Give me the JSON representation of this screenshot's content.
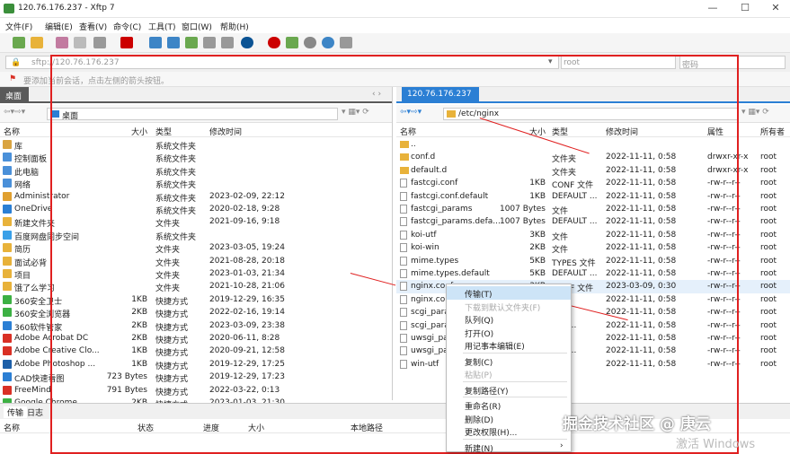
{
  "window": {
    "title": "120.76.176.237 - Xftp 7",
    "min": "—",
    "max": "☐",
    "close": "✕"
  },
  "menu": [
    "文件(F)",
    "编辑(E)",
    "查看(V)",
    "命令(C)",
    "工具(T)",
    "窗口(W)",
    "帮助(H)"
  ],
  "address": {
    "url": "sftp://120.76.176.237",
    "user_placeholder": "root",
    "pass_placeholder": "密码"
  },
  "hint": "要添加当前会话，点击左侧的箭头按钮。",
  "left": {
    "tab": "桌面",
    "path": "桌面",
    "headers": [
      "名称",
      "大小",
      "类型",
      "修改时间"
    ],
    "rows": [
      {
        "name": "库",
        "size": "",
        "type": "系统文件夹",
        "time": "",
        "c": "#d9a441"
      },
      {
        "name": "控制面板",
        "size": "",
        "type": "系统文件夹",
        "time": "",
        "c": "#4a90d9"
      },
      {
        "name": "此电脑",
        "size": "",
        "type": "系统文件夹",
        "time": "",
        "c": "#4a90d9"
      },
      {
        "name": "网络",
        "size": "",
        "type": "系统文件夹",
        "time": "",
        "c": "#4a90d9"
      },
      {
        "name": "Administrator",
        "size": "",
        "type": "系统文件夹",
        "time": "2023-02-09, 22:12",
        "c": "#e0a030"
      },
      {
        "name": "OneDrive",
        "size": "",
        "type": "系统文件夹",
        "time": "2020-02-18, 9:28",
        "c": "#2b7fd4"
      },
      {
        "name": "新建文件夹",
        "size": "",
        "type": "文件夹",
        "time": "2021-09-16, 9:18",
        "c": "#e8b23a"
      },
      {
        "name": "百度网盘同步空间",
        "size": "",
        "type": "系统文件夹",
        "time": "",
        "c": "#3aa0e8"
      },
      {
        "name": "简历",
        "size": "",
        "type": "文件夹",
        "time": "2023-03-05, 19:24",
        "c": "#e8b23a"
      },
      {
        "name": "面试必背",
        "size": "",
        "type": "文件夹",
        "time": "2021-08-28, 20:18",
        "c": "#e8b23a"
      },
      {
        "name": "项目",
        "size": "",
        "type": "文件夹",
        "time": "2023-01-03, 21:34",
        "c": "#e8b23a"
      },
      {
        "name": "饿了么学习",
        "size": "",
        "type": "文件夹",
        "time": "2021-10-28, 21:06",
        "c": "#e8b23a"
      },
      {
        "name": "360安全卫士",
        "size": "1KB",
        "type": "快捷方式",
        "time": "2019-12-29, 16:35",
        "c": "#3cb043"
      },
      {
        "name": "360安全浏览器",
        "size": "2KB",
        "type": "快捷方式",
        "time": "2022-02-16, 19:14",
        "c": "#3cb043"
      },
      {
        "name": "360软件管家",
        "size": "2KB",
        "type": "快捷方式",
        "time": "2023-03-09, 23:38",
        "c": "#2b7fd4"
      },
      {
        "name": "Adobe Acrobat DC",
        "size": "2KB",
        "type": "快捷方式",
        "time": "2020-06-11, 8:28",
        "c": "#d93025"
      },
      {
        "name": "Adobe Creative Clo...",
        "size": "1KB",
        "type": "快捷方式",
        "time": "2020-09-21, 12:58",
        "c": "#d93025"
      },
      {
        "name": "Adobe Photoshop ...",
        "size": "1KB",
        "type": "快捷方式",
        "time": "2019-12-29, 17:25",
        "c": "#1d5fa8"
      },
      {
        "name": "CAD快速看图",
        "size": "723 Bytes",
        "type": "快捷方式",
        "time": "2019-12-29, 17:23",
        "c": "#2b7fd4"
      },
      {
        "name": "FreeMind",
        "size": "791 Bytes",
        "type": "快捷方式",
        "time": "2022-03-22, 0:13",
        "c": "#d93025"
      },
      {
        "name": "Google Chrome",
        "size": "2KB",
        "type": "快捷方式",
        "time": "2023-01-03, 21:30",
        "c": "#3cb043"
      }
    ]
  },
  "right": {
    "tab": "120.76.176.237",
    "path": "/etc/nginx",
    "headers": [
      "名称",
      "大小",
      "类型",
      "修改时间",
      "属性",
      "所有者"
    ],
    "rows": [
      {
        "name": "..",
        "size": "",
        "type": "",
        "time": "",
        "attr": "",
        "owner": "",
        "f": 1
      },
      {
        "name": "conf.d",
        "size": "",
        "type": "文件夹",
        "time": "2022-11-11, 0:58",
        "attr": "drwxr-xr-x",
        "owner": "root",
        "f": 1
      },
      {
        "name": "default.d",
        "size": "",
        "type": "文件夹",
        "time": "2022-11-11, 0:58",
        "attr": "drwxr-xr-x",
        "owner": "root",
        "f": 1
      },
      {
        "name": "fastcgi.conf",
        "size": "1KB",
        "type": "CONF 文件",
        "time": "2022-11-11, 0:58",
        "attr": "-rw-r--r--",
        "owner": "root",
        "f": 0
      },
      {
        "name": "fastcgi.conf.default",
        "size": "1KB",
        "type": "DEFAULT ...",
        "time": "2022-11-11, 0:58",
        "attr": "-rw-r--r--",
        "owner": "root",
        "f": 0
      },
      {
        "name": "fastcgi_params",
        "size": "1007 Bytes",
        "type": "文件",
        "time": "2022-11-11, 0:58",
        "attr": "-rw-r--r--",
        "owner": "root",
        "f": 0
      },
      {
        "name": "fastcgi_params.defa...",
        "size": "1007 Bytes",
        "type": "DEFAULT ...",
        "time": "2022-11-11, 0:58",
        "attr": "-rw-r--r--",
        "owner": "root",
        "f": 0
      },
      {
        "name": "koi-utf",
        "size": "3KB",
        "type": "文件",
        "time": "2022-11-11, 0:58",
        "attr": "-rw-r--r--",
        "owner": "root",
        "f": 0
      },
      {
        "name": "koi-win",
        "size": "2KB",
        "type": "文件",
        "time": "2022-11-11, 0:58",
        "attr": "-rw-r--r--",
        "owner": "root",
        "f": 0
      },
      {
        "name": "mime.types",
        "size": "5KB",
        "type": "TYPES 文件",
        "time": "2022-11-11, 0:58",
        "attr": "-rw-r--r--",
        "owner": "root",
        "f": 0
      },
      {
        "name": "mime.types.default",
        "size": "5KB",
        "type": "DEFAULT ...",
        "time": "2022-11-11, 0:58",
        "attr": "-rw-r--r--",
        "owner": "root",
        "f": 0
      },
      {
        "name": "nginx.conf",
        "size": "3KB",
        "type": "CONF 文件",
        "time": "2023-03-09, 0:30",
        "attr": "-rw-r--r--",
        "owner": "root",
        "f": 0,
        "sel": 1
      },
      {
        "name": "nginx.conf.default",
        "size": "",
        "type": "",
        "time": "2022-11-11, 0:58",
        "attr": "-rw-r--r--",
        "owner": "root",
        "f": 0
      },
      {
        "name": "scgi_params",
        "size": "",
        "type": "",
        "time": "2022-11-11, 0:58",
        "attr": "-rw-r--r--",
        "owner": "root",
        "f": 0
      },
      {
        "name": "scgi_params.default",
        "size": "",
        "type": "ULT ...",
        "time": "2022-11-11, 0:58",
        "attr": "-rw-r--r--",
        "owner": "root",
        "f": 0
      },
      {
        "name": "uwsgi_params",
        "size": "",
        "type": "",
        "time": "2022-11-11, 0:58",
        "attr": "-rw-r--r--",
        "owner": "root",
        "f": 0
      },
      {
        "name": "uwsgi_params.default",
        "size": "",
        "type": "ULT ...",
        "time": "2022-11-11, 0:58",
        "attr": "-rw-r--r--",
        "owner": "root",
        "f": 0
      },
      {
        "name": "win-utf",
        "size": "",
        "type": "",
        "time": "2022-11-11, 0:58",
        "attr": "-rw-r--r--",
        "owner": "root",
        "f": 0
      }
    ]
  },
  "context_menu": [
    {
      "label": "传输(T)",
      "hl": 1
    },
    {
      "label": "下载到默认文件夹(F)",
      "dis": 1
    },
    {
      "label": "队列(Q)"
    },
    {
      "label": "打开(O)"
    },
    {
      "label": "用记事本编辑(E)"
    },
    {
      "label": "复制(C)",
      "sep": 1
    },
    {
      "label": "粘贴(P)",
      "dis": 1
    },
    {
      "label": "复制路径(Y)",
      "sep": 1
    },
    {
      "label": "重命名(R)",
      "sep": 1
    },
    {
      "label": "删除(D)"
    },
    {
      "label": "更改权限(H)..."
    },
    {
      "label": "新建(N)",
      "sep": 1,
      "sub": "›"
    }
  ],
  "bottom": {
    "tab1": "传输",
    "tab2": "日志",
    "cols": [
      "名称",
      "状态",
      "进度",
      "大小",
      "本地路径"
    ]
  },
  "watermark": "掘金技术社区 @ 庚云",
  "activate": "激活 Windows"
}
